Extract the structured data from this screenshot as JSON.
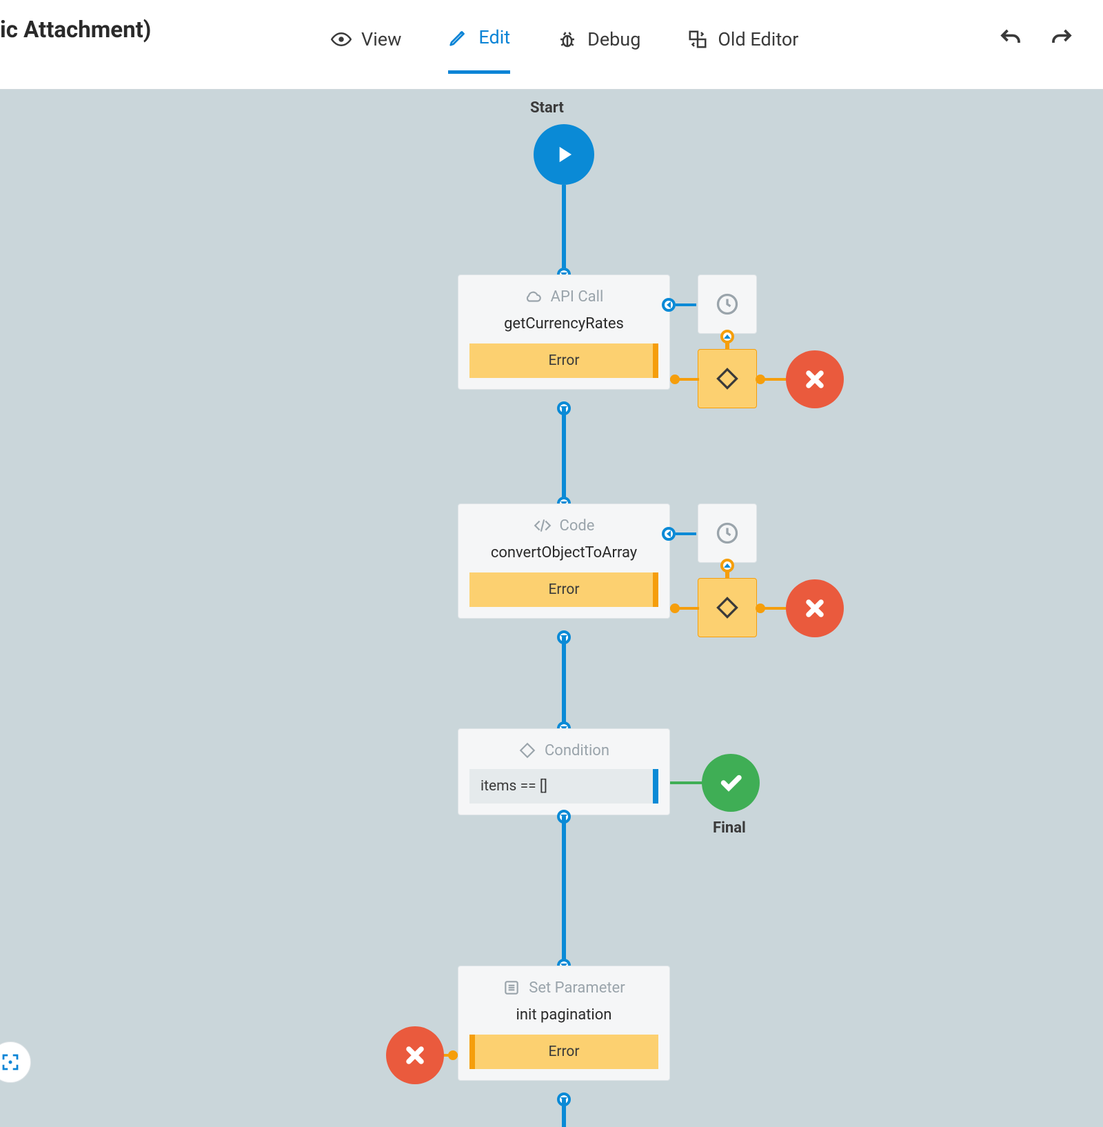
{
  "header": {
    "title_fragment": "ic Attachment)",
    "tabs": {
      "view": "View",
      "edit": "Edit",
      "debug": "Debug",
      "old_editor": "Old Editor"
    }
  },
  "flow": {
    "start_label": "Start",
    "final_label": "Final",
    "nodes": {
      "api_call": {
        "type": "API Call",
        "name": "getCurrencyRates",
        "error": "Error"
      },
      "code": {
        "type": "Code",
        "name": "convertObjectToArray",
        "error": "Error"
      },
      "condition": {
        "type": "Condition",
        "expr": "items == []"
      },
      "set_param": {
        "type": "Set Parameter",
        "name": "init pagination",
        "error": "Error"
      }
    }
  }
}
